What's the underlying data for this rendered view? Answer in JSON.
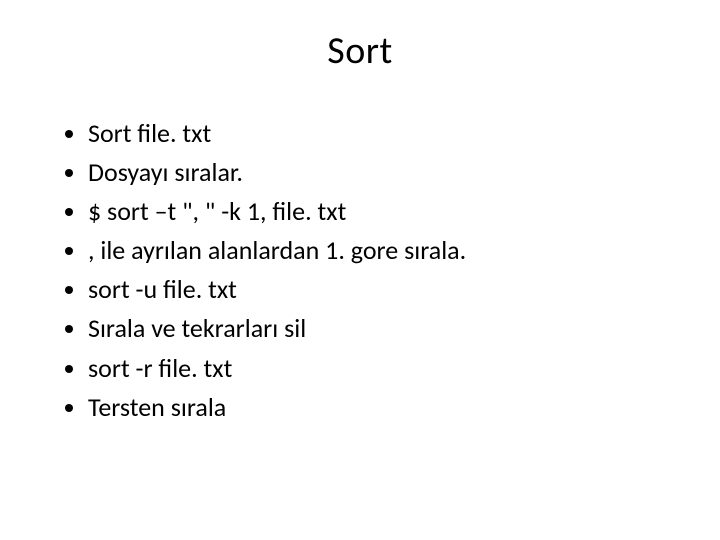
{
  "title": "Sort",
  "bullets": [
    "Sort file. txt",
    "Dosyayı sıralar.",
    "$ sort –t \", \" -k 1,  file. txt",
    ", ile ayrılan alanlardan 1. gore sırala.",
    "sort -u file. txt",
    "Sırala ve tekrarları sil",
    "sort -r file. txt",
    "Tersten sırala"
  ]
}
